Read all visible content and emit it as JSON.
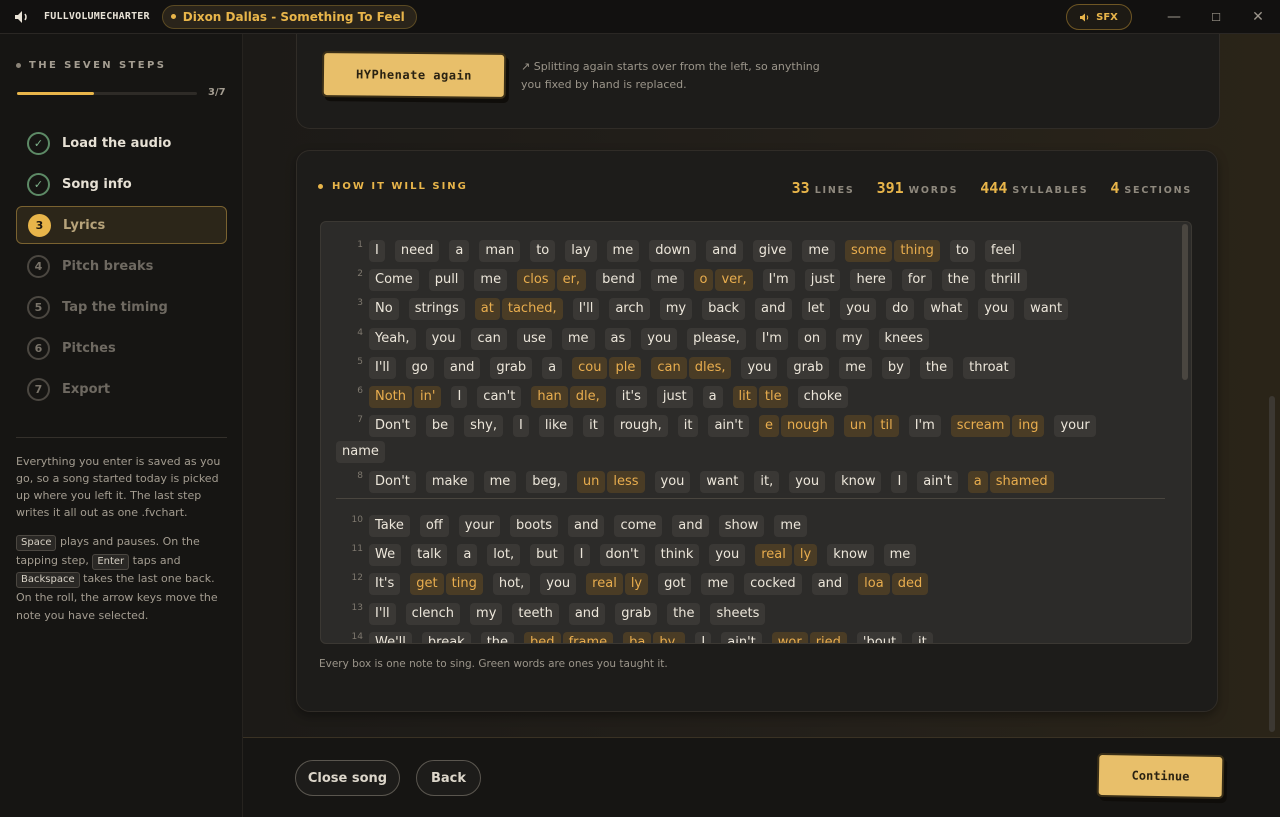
{
  "app": {
    "logo": "FULLVOLUMECHARTER",
    "song_pill": "Dixon Dallas - Something To Feel",
    "sfx": "SFX",
    "win_min": "—",
    "win_max": "☐",
    "win_close": "✕"
  },
  "sidebar": {
    "heading": "THE SEVEN STEPS",
    "progress_text": "3/7",
    "progress_fraction": 0.43,
    "steps": [
      {
        "num": "✓",
        "label": "Load the audio",
        "state": "done"
      },
      {
        "num": "✓",
        "label": "Song info",
        "state": "done"
      },
      {
        "num": "3",
        "label": "Lyrics",
        "state": "active"
      },
      {
        "num": "4",
        "label": "Pitch breaks",
        "state": "todo"
      },
      {
        "num": "5",
        "label": "Tap the timing",
        "state": "todo"
      },
      {
        "num": "6",
        "label": "Pitches",
        "state": "todo"
      },
      {
        "num": "7",
        "label": "Export",
        "state": "todo"
      }
    ],
    "note": "Everything you enter is saved as you go, so a song started today is picked up where you left it. The last step writes it all out as one .fvchart.",
    "keys": {
      "space": "Space",
      "space_text": "plays and pauses. On the tapping step,",
      "enter": "Enter",
      "enter_text": "taps and",
      "backspace": "Backspace",
      "backspace_text": "takes the last one back. On the roll, the arrow keys move the note you have selected."
    }
  },
  "hyphenate": {
    "button": "HYPhenate again",
    "note": "↗ Splitting again starts over from the left, so anything you fixed by hand is replaced."
  },
  "sing": {
    "heading": "HOW IT WILL SING",
    "stats": [
      {
        "value": "33",
        "label": "LINES"
      },
      {
        "value": "391",
        "label": "WORDS"
      },
      {
        "value": "444",
        "label": "SYLLABLES"
      },
      {
        "value": "4",
        "label": "SECTIONS"
      }
    ],
    "footer": "Every box is one note to sing. Green words are ones you taught it."
  },
  "lyrics": [
    {
      "n": "1",
      "words": [
        [
          "I"
        ],
        [
          "need"
        ],
        [
          "a"
        ],
        [
          "man"
        ],
        [
          "to"
        ],
        [
          "lay"
        ],
        [
          "me"
        ],
        [
          "down"
        ],
        [
          "and"
        ],
        [
          "give"
        ],
        [
          "me"
        ],
        [
          "some",
          "thing"
        ],
        [
          "to"
        ],
        [
          "feel"
        ]
      ]
    },
    {
      "n": "2",
      "words": [
        [
          "Come"
        ],
        [
          "pull"
        ],
        [
          "me"
        ],
        [
          "clos",
          "er,"
        ],
        [
          "bend"
        ],
        [
          "me"
        ],
        [
          "o",
          "ver,"
        ],
        [
          "I'm"
        ],
        [
          "just"
        ],
        [
          "here"
        ],
        [
          "for"
        ],
        [
          "the"
        ],
        [
          "thrill"
        ]
      ]
    },
    {
      "n": "3",
      "words": [
        [
          "No"
        ],
        [
          "strings"
        ],
        [
          "at",
          "tached,"
        ],
        [
          "I'll"
        ],
        [
          "arch"
        ],
        [
          "my"
        ],
        [
          "back"
        ],
        [
          "and"
        ],
        [
          "let"
        ],
        [
          "you"
        ],
        [
          "do"
        ],
        [
          "what"
        ],
        [
          "you"
        ],
        [
          "want"
        ]
      ]
    },
    {
      "n": "4",
      "words": [
        [
          "Yeah,"
        ],
        [
          "you"
        ],
        [
          "can"
        ],
        [
          "use"
        ],
        [
          "me"
        ],
        [
          "as"
        ],
        [
          "you"
        ],
        [
          "please,"
        ],
        [
          "I'm"
        ],
        [
          "on"
        ],
        [
          "my"
        ],
        [
          "knees"
        ]
      ]
    },
    {
      "n": "5",
      "words": [
        [
          "I'll"
        ],
        [
          "go"
        ],
        [
          "and"
        ],
        [
          "grab"
        ],
        [
          "a"
        ],
        [
          "cou",
          "ple"
        ],
        [
          "can",
          "dles,"
        ],
        [
          "you"
        ],
        [
          "grab"
        ],
        [
          "me"
        ],
        [
          "by"
        ],
        [
          "the"
        ],
        [
          "throat"
        ]
      ]
    },
    {
      "n": "6",
      "words": [
        [
          "Noth",
          "in'"
        ],
        [
          "I"
        ],
        [
          "can't"
        ],
        [
          "han",
          "dle,"
        ],
        [
          "it's"
        ],
        [
          "just"
        ],
        [
          "a"
        ],
        [
          "lit",
          "tle"
        ],
        [
          "choke"
        ]
      ]
    },
    {
      "n": "7",
      "words": [
        [
          "Don't"
        ],
        [
          "be"
        ],
        [
          "shy,"
        ],
        [
          "I"
        ],
        [
          "like"
        ],
        [
          "it"
        ],
        [
          "rough,"
        ],
        [
          "it"
        ],
        [
          "ain't"
        ],
        [
          "e",
          "nough"
        ],
        [
          "un",
          "til"
        ],
        [
          "I'm"
        ],
        [
          "scream",
          "ing"
        ],
        [
          "your"
        ]
      ],
      "wrap": [
        [
          "name"
        ]
      ]
    },
    {
      "n": "8",
      "words": [
        [
          "Don't"
        ],
        [
          "make"
        ],
        [
          "me"
        ],
        [
          "beg,"
        ],
        [
          "un",
          "less"
        ],
        [
          "you"
        ],
        [
          "want"
        ],
        [
          "it,"
        ],
        [
          "you"
        ],
        [
          "know"
        ],
        [
          "I"
        ],
        [
          "ain't"
        ],
        [
          "a",
          "shamed"
        ]
      ]
    },
    {
      "n": "10",
      "words": [
        [
          "Take"
        ],
        [
          "off"
        ],
        [
          "your"
        ],
        [
          "boots"
        ],
        [
          "and"
        ],
        [
          "come"
        ],
        [
          "and"
        ],
        [
          "show"
        ],
        [
          "me"
        ]
      ]
    },
    {
      "n": "11",
      "words": [
        [
          "We"
        ],
        [
          "talk"
        ],
        [
          "a"
        ],
        [
          "lot,"
        ],
        [
          "but"
        ],
        [
          "I"
        ],
        [
          "don't"
        ],
        [
          "think"
        ],
        [
          "you"
        ],
        [
          "real",
          "ly"
        ],
        [
          "know"
        ],
        [
          "me"
        ]
      ]
    },
    {
      "n": "12",
      "words": [
        [
          "It's"
        ],
        [
          "get",
          "ting"
        ],
        [
          "hot,"
        ],
        [
          "you"
        ],
        [
          "real",
          "ly"
        ],
        [
          "got"
        ],
        [
          "me"
        ],
        [
          "cocked"
        ],
        [
          "and"
        ],
        [
          "loa",
          "ded"
        ]
      ]
    },
    {
      "n": "13",
      "words": [
        [
          "I'll"
        ],
        [
          "clench"
        ],
        [
          "my"
        ],
        [
          "teeth"
        ],
        [
          "and"
        ],
        [
          "grab"
        ],
        [
          "the"
        ],
        [
          "sheets"
        ]
      ]
    },
    {
      "n": "14",
      "words": [
        [
          "We'll"
        ],
        [
          "break"
        ],
        [
          "the"
        ],
        [
          "bed",
          "frame"
        ],
        [
          "ba",
          "by,"
        ],
        [
          "I"
        ],
        [
          "ain't"
        ],
        [
          "wor",
          "ried"
        ],
        [
          "'bout"
        ],
        [
          "it"
        ]
      ]
    }
  ],
  "footer": {
    "close": "Close song",
    "back": "Back",
    "continue": "Continue"
  },
  "colors": {
    "accent": "#e8b54a",
    "done": "#7fb38b",
    "hyphen_fill": "#4a3c25"
  }
}
